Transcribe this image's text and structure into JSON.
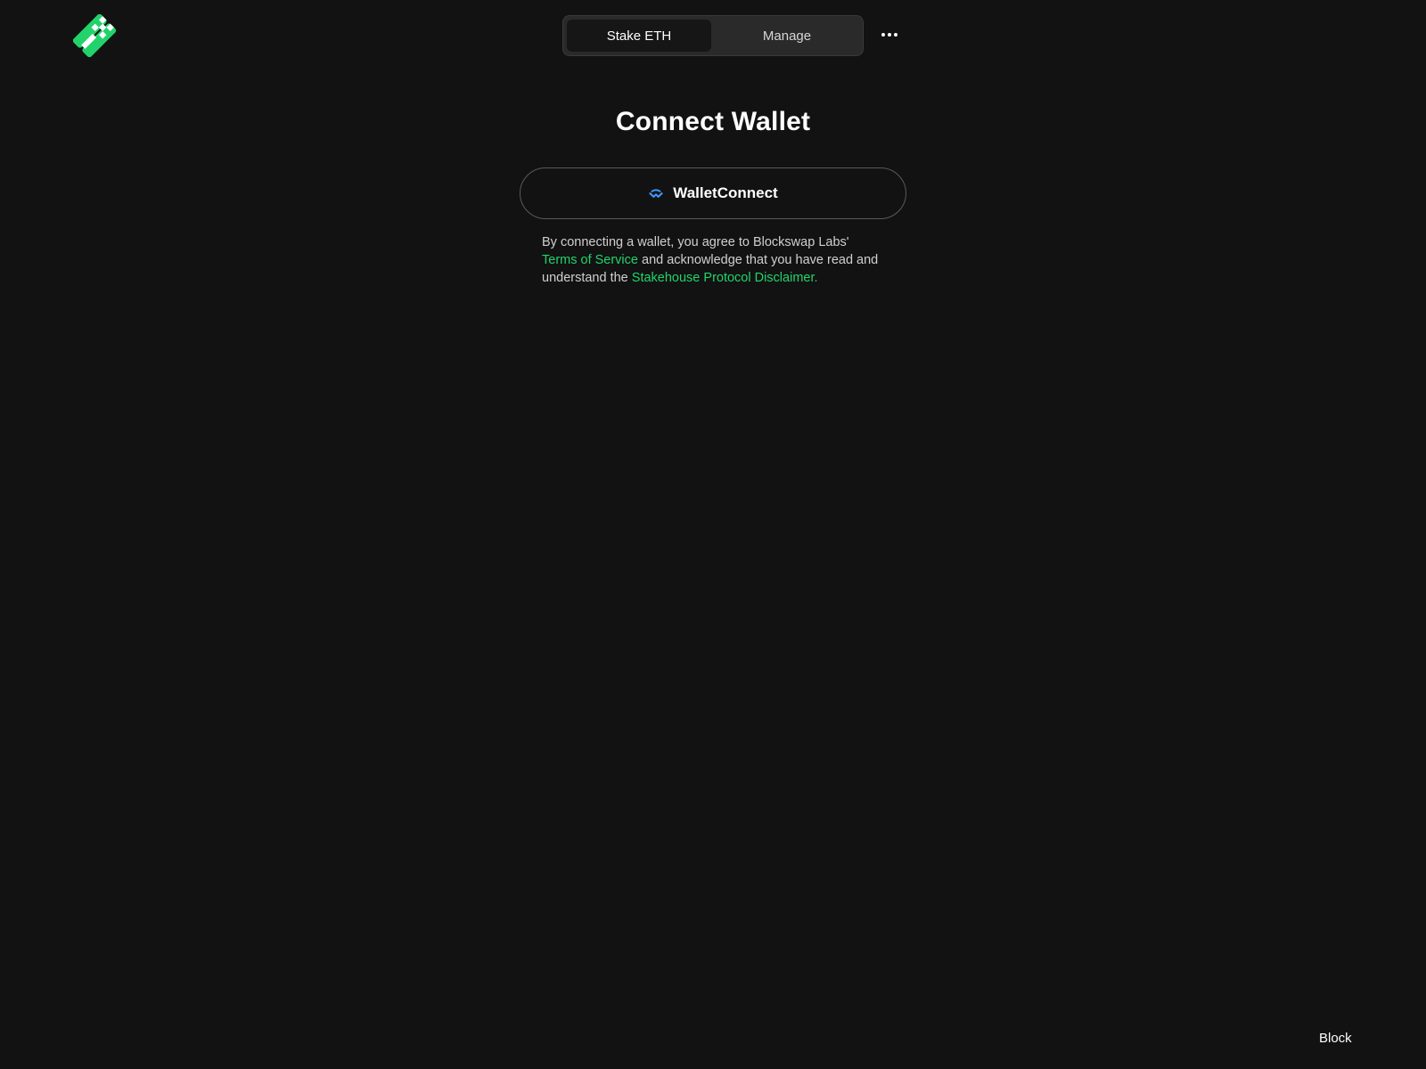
{
  "header": {
    "logo_icon": "blockswap-logo-icon",
    "tabs": [
      {
        "label": "Stake ETH",
        "active": true
      },
      {
        "label": "Manage",
        "active": false
      }
    ],
    "more_icon": "ellipsis-icon"
  },
  "main": {
    "title": "Connect Wallet",
    "wallet_option": {
      "label": "WalletConnect",
      "icon": "walletconnect-icon",
      "icon_color": "#3b99fc"
    },
    "disclaimer": {
      "part1": "By connecting a wallet, you agree to Blockswap Labs'",
      "terms_link": "Terms of Service",
      "part2": " and acknowledge that you have read and understand the ",
      "disclaimer_link": "Stakehouse Protocol Disclaimer."
    }
  },
  "footer": {
    "block_label": "Block"
  },
  "colors": {
    "background": "#121212",
    "accent_green": "#22d36b",
    "tab_bg": "#2a2a2a",
    "tab_active_bg": "#161616"
  }
}
